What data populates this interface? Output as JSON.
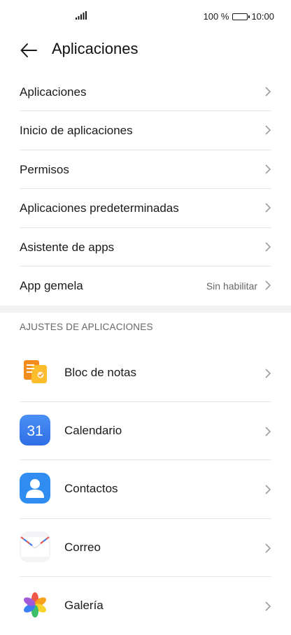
{
  "status_bar": {
    "battery": "100 %",
    "time": "10:00"
  },
  "header": {
    "title": "Aplicaciones"
  },
  "menu": [
    {
      "label": "Aplicaciones",
      "value": ""
    },
    {
      "label": "Inicio de aplicaciones",
      "value": ""
    },
    {
      "label": "Permisos",
      "value": ""
    },
    {
      "label": "Aplicaciones predeterminadas",
      "value": ""
    },
    {
      "label": "Asistente de apps",
      "value": ""
    },
    {
      "label": "App gemela",
      "value": "Sin habilitar"
    }
  ],
  "section": {
    "title": "AJUSTES DE APLICACIONES"
  },
  "apps": [
    {
      "label": "Bloc de notas",
      "icon": "notepad-icon"
    },
    {
      "label": "Calendario",
      "icon": "calendar-icon",
      "icon_text": "31"
    },
    {
      "label": "Contactos",
      "icon": "contacts-icon"
    },
    {
      "label": "Correo",
      "icon": "mail-icon"
    },
    {
      "label": "Galería",
      "icon": "gallery-icon"
    }
  ],
  "colors": {
    "calendar_blue": "#3b7ff2",
    "contacts_blue": "#2f8cf0",
    "notes_orange": "#f7a21b"
  }
}
